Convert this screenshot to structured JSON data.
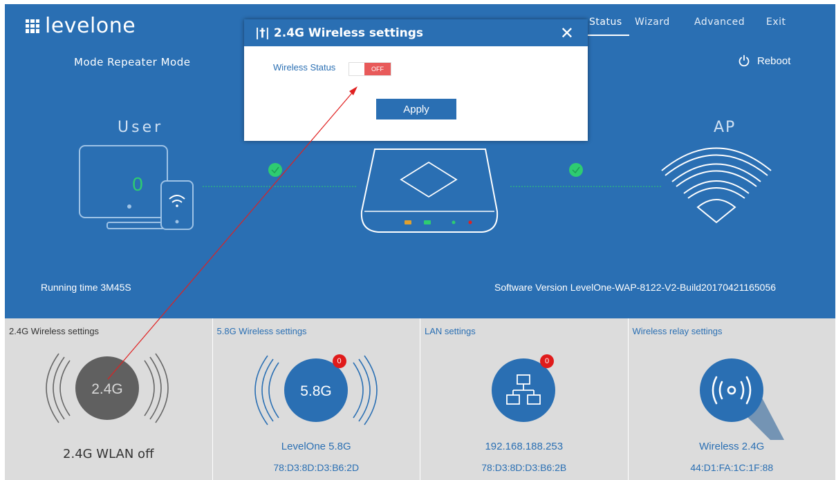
{
  "brand": {
    "logo_text": "levelone"
  },
  "nav": {
    "status": "Status",
    "wizard": "Wizard",
    "advanced": "Advanced",
    "exit": "Exit"
  },
  "mode": "Mode  Repeater Mode",
  "reboot_label": "Reboot",
  "topology": {
    "user_label": "User",
    "user_count": "0",
    "ap_label": "AP"
  },
  "running_time": "Running time  3M45S",
  "software_version": "Software Version  LevelOne-WAP-8122-V2-Build20170421165056",
  "cards": [
    {
      "title": "2.4G Wireless settings",
      "icon_text": "2.4G",
      "line1": "2.4G WLAN off"
    },
    {
      "title": "5.8G Wireless settings",
      "icon_text": "5.8G",
      "badge": "0",
      "line1": "LevelOne 5.8G",
      "line2": "78:D3:8D:D3:B6:2D"
    },
    {
      "title": "LAN settings",
      "badge": "0",
      "line1": "192.168.188.253",
      "line2": "78:D3:8D:D3:B6:2B"
    },
    {
      "title": "Wireless relay settings",
      "line1": "Wireless 2.4G",
      "line2": "44:D1:FA:1C:1F:88"
    }
  ],
  "modal": {
    "title": "2.4G Wireless settings",
    "close": "✕",
    "wireless_status_label": "Wireless Status",
    "toggle_state": "OFF",
    "apply_label": "Apply"
  },
  "colors": {
    "primary": "#2a6fb3",
    "ok_green": "#2ecc71",
    "badge_red": "#e01b1b",
    "toggle_off": "#e85a5a",
    "annotation_arrow": "#e02020"
  }
}
